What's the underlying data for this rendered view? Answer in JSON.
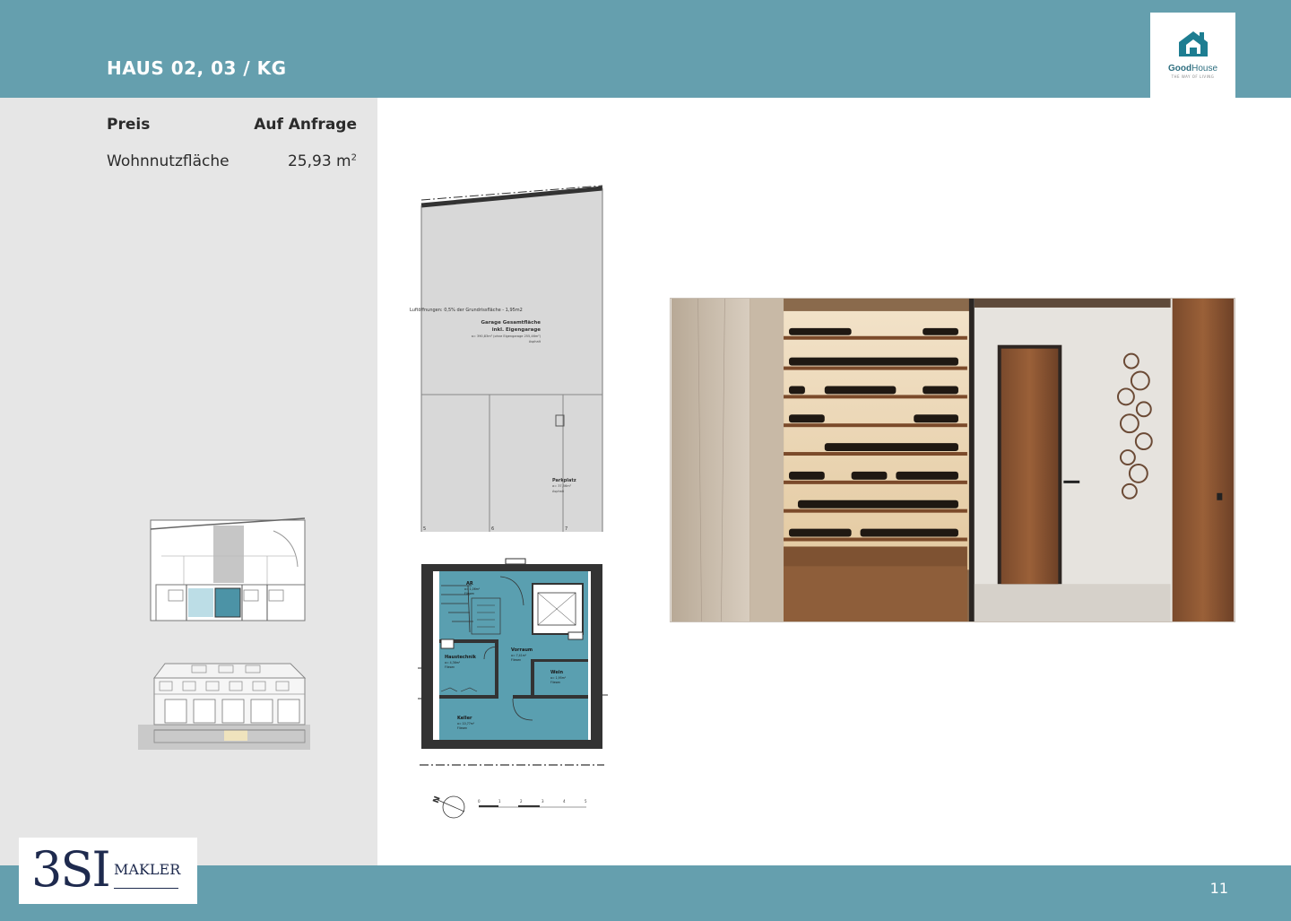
{
  "header": {
    "title": "HAUS 02, 03 /  KG"
  },
  "logo": {
    "name_bold": "Good",
    "name_light": "House",
    "tagline": "THE WAY OF LIVING",
    "color": "#1d7d91"
  },
  "details": {
    "price_label": "Preis",
    "price_value": "Auf Anfrage",
    "area_label": "Wohnnutzfläche",
    "area_value": "25,93 m",
    "area_unit_sup": "2"
  },
  "floorplan": {
    "garage_note": "Luftöffnungen: 0,5% der Grundrissfläche - 1,95m2",
    "garage_title": "Garage Gesamtfläche",
    "garage_subtitle": "inkl. Eigengarage",
    "garage_area": "a= 390,83m² (ohne Eigengarage 255,46m²)",
    "garage_floor": "Asphalt",
    "parking_label": "Parkplatz",
    "parking_area": "a= 37,56m²",
    "parking_floor": "Asphalt",
    "stall_numbers": [
      "5",
      "6",
      "7"
    ],
    "rooms": [
      {
        "name": "AR",
        "area": "a= 1,06m²",
        "floor": "Fliesen"
      },
      {
        "name": "Vorraum",
        "area": "a= 7,41m²",
        "floor": "Fliesen"
      },
      {
        "name": "Haustechnik",
        "area": "a= 4,36m²",
        "floor": "Fliesen"
      },
      {
        "name": "Wein",
        "area": "a= 1,95m²",
        "floor": "Fliesen"
      },
      {
        "name": "Keller",
        "area": "a= 10,77m²",
        "floor": "Fliesen"
      }
    ],
    "north_label": "N",
    "scale_labels": [
      "0",
      "1",
      "2",
      "3",
      "4",
      "5"
    ],
    "highlight_color": "#5a9fb0"
  },
  "footer": {
    "page_number": "11",
    "brand_main": "3SI",
    "brand_sub": "MAKLER"
  }
}
